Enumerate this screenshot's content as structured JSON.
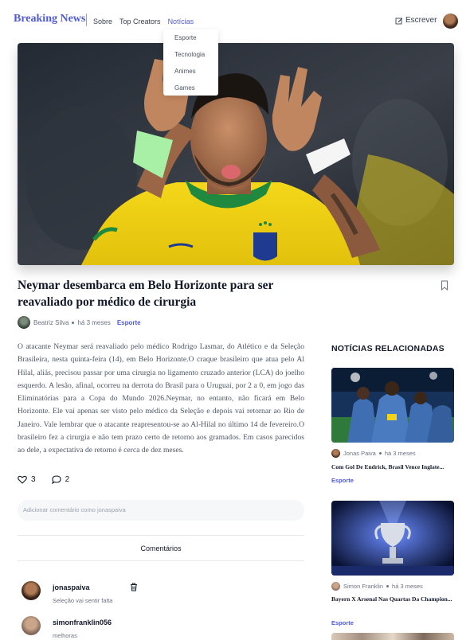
{
  "header": {
    "brand": "Breaking News",
    "nav": [
      {
        "label": "Sobre",
        "active": false
      },
      {
        "label": "Top Creators",
        "active": false
      },
      {
        "label": "Notícias",
        "active": true
      }
    ],
    "write_label": "Escrever",
    "dropdown": [
      "Esporte",
      "Tecnologia",
      "Animes",
      "Games"
    ]
  },
  "article": {
    "title": "Neymar desembarca em Belo Horizonte para ser reavaliado por médico de cirurgia",
    "author": "Beatriz Silva",
    "time": "há 3 meses",
    "category": "Esporte",
    "body": "O atacante Neymar será reavaliado pelo médico Rodrigo Lasmar, do Atlético e da Seleção Brasileira, nesta quinta-feira (14), em Belo Horizonte.O craque brasileiro que atua pelo Al Hilal, aliás, precisou passar por uma cirurgia no ligamento cruzado anterior (LCA) do joelho esquerdo. A lesão, afinal, ocorreu na derrota do Brasil para o Uruguai, por 2 a 0, em jogo das Eliminatórias para a Copa do Mundo 2026.Neymar, no entanto, não ficará em Belo Horizonte. Ele vai apenas ser visto pelo médico da Seleção e depois vai retornar ao Rio de Janeiro. Vale lembrar que o atacante reapresentou-se ao Al-Hilal no último 14 de fevereiro.O brasileiro fez a cirurgia e não tem prazo certo de retorno aos gramados. Em casos parecidos ao dele, a expectativa de retorno é cerca de dez meses.",
    "likes": "3",
    "comments_count": "2",
    "comment_placeholder": "Adicionar comentário como jonaspaiva",
    "comments_heading": "Comentários",
    "comments": [
      {
        "user": "jonaspaiva",
        "text": "Seleção vai sentir falta"
      },
      {
        "user": "simonfranklin056",
        "text": "melhoras"
      }
    ]
  },
  "sidebar": {
    "title": "NOTÍCIAS RELACIONADAS",
    "cards": [
      {
        "author": "Jonas Paiva",
        "time": "há 3 meses",
        "title": "Com Gol De Endrick, Brasil Vence Inglate...",
        "category": "Esporte"
      },
      {
        "author": "Simon Franklin",
        "time": "há 3 meses",
        "title": "Bayern X Arsenal Nas Quartas Da Champion...",
        "category": "Esporte"
      }
    ]
  },
  "colors": {
    "accent": "#4f5bd5",
    "brazil_yellow": "#f2d31a",
    "brazil_green": "#1f8a3f"
  }
}
